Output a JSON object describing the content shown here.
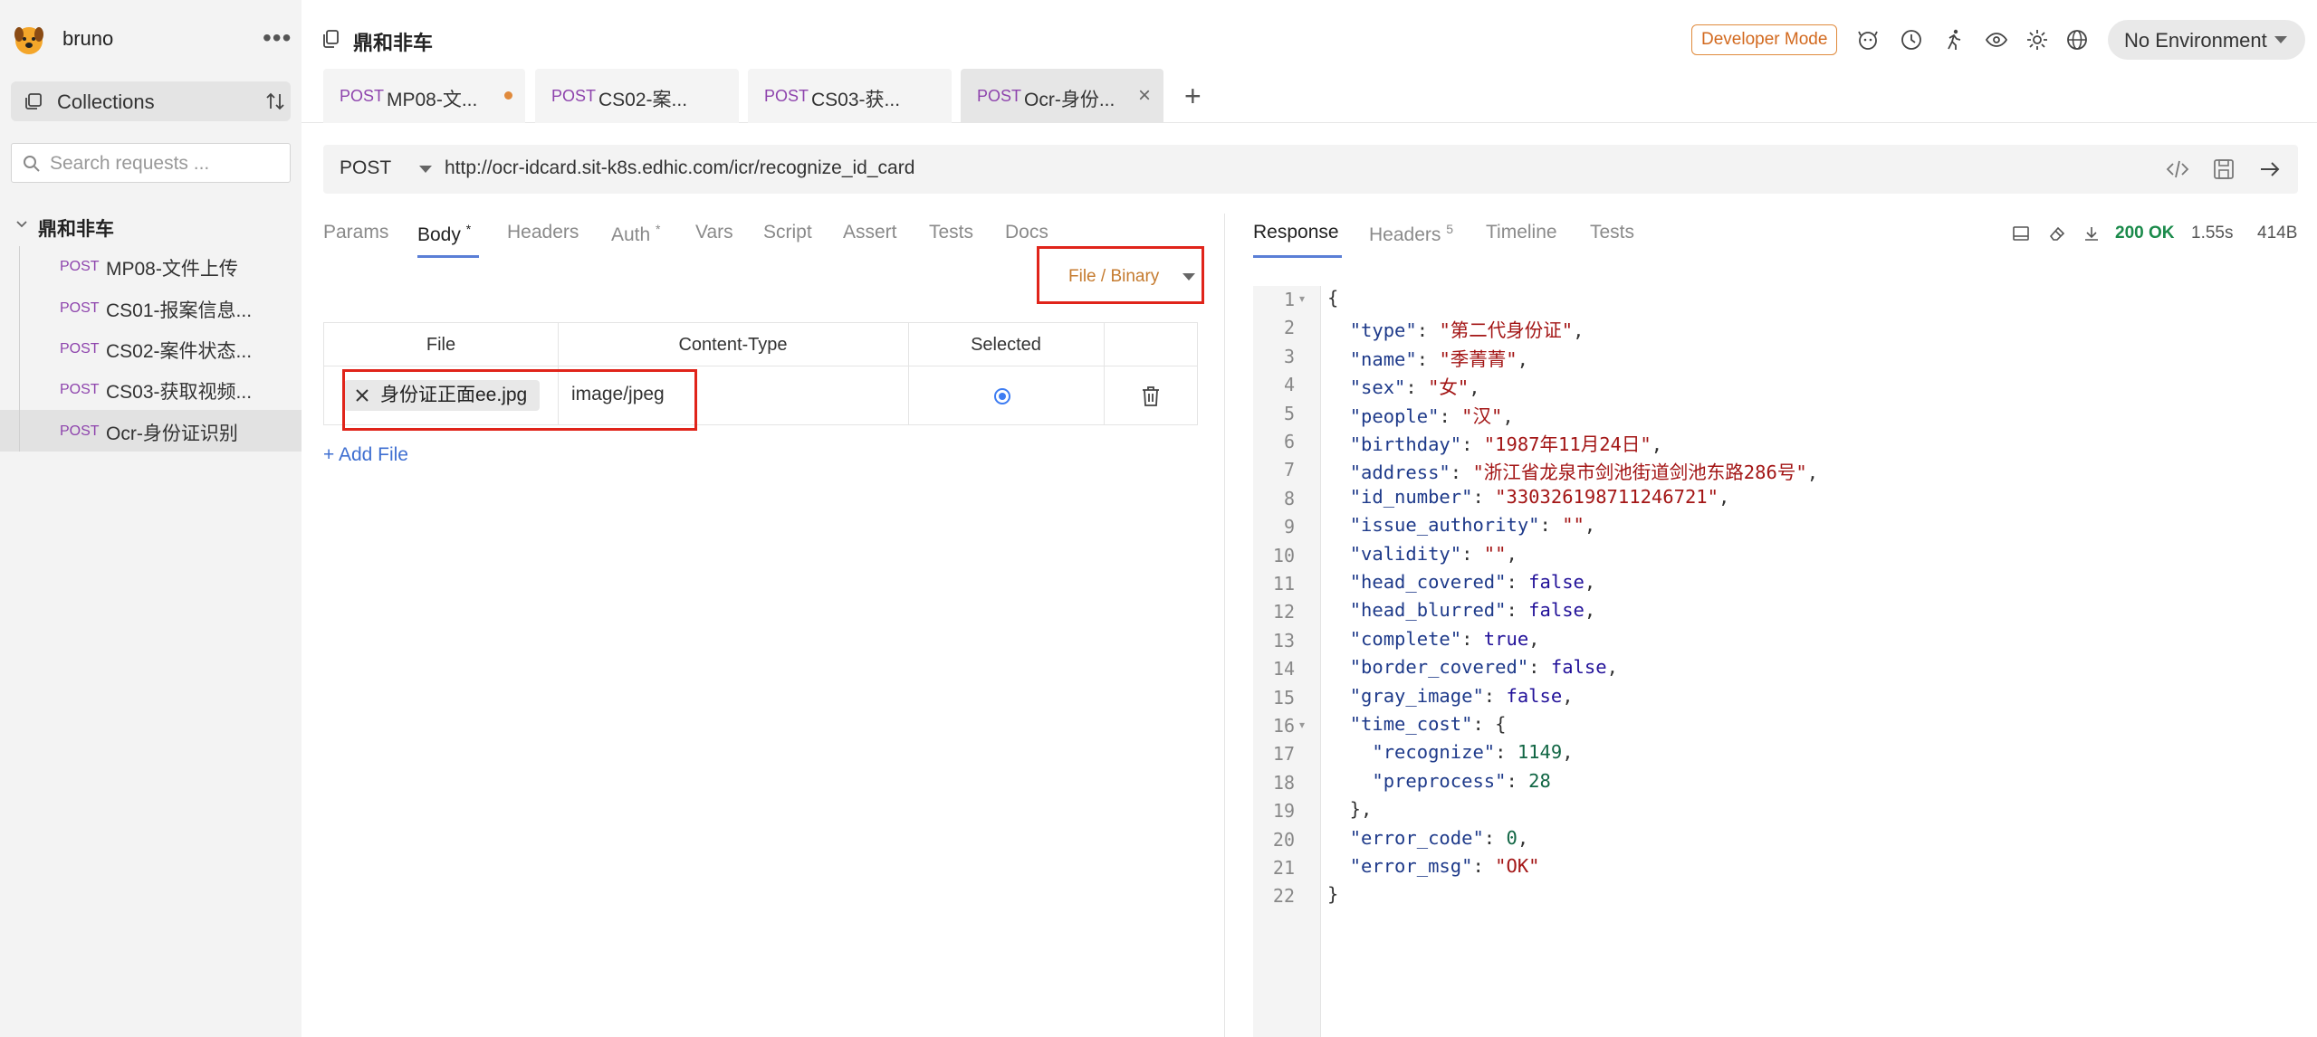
{
  "app": {
    "name": "bruno"
  },
  "sidebar": {
    "collections_label": "Collections",
    "search_placeholder": "Search requests ...",
    "collection_name": "鼎和非车",
    "requests": [
      {
        "method": "POST",
        "name": "MP08-文件上传",
        "active": false
      },
      {
        "method": "POST",
        "name": "CS01-报案信息...",
        "active": false
      },
      {
        "method": "POST",
        "name": "CS02-案件状态...",
        "active": false
      },
      {
        "method": "POST",
        "name": "CS03-获取视频...",
        "active": false
      },
      {
        "method": "POST",
        "name": "Ocr-身份证识别",
        "active": true
      }
    ]
  },
  "topbar": {
    "title": "鼎和非车",
    "developer_mode": "Developer Mode",
    "environment": "No Environment",
    "icons": [
      "dog-icon",
      "history-icon",
      "runner-icon",
      "eye-icon",
      "gear-icon",
      "globe-icon"
    ]
  },
  "tabs": [
    {
      "method": "POST",
      "name": "MP08-文...",
      "unsaved": true
    },
    {
      "method": "POST",
      "name": "CS02-案...",
      "unsaved": false
    },
    {
      "method": "POST",
      "name": "CS03-获...",
      "unsaved": false
    },
    {
      "method": "POST",
      "name": "Ocr-身份...",
      "active": true
    }
  ],
  "request": {
    "method": "POST",
    "url": "http://ocr-idcard.sit-k8s.edhic.com/icr/recognize_id_card",
    "tabs": [
      "Params",
      "Body",
      "Headers",
      "Auth",
      "Vars",
      "Script",
      "Assert",
      "Tests",
      "Docs"
    ],
    "active_tab": "Body",
    "body_mode": "File / Binary",
    "table_headers": [
      "File",
      "Content-Type",
      "Selected"
    ],
    "file": {
      "name": "身份证正面ee.jpg",
      "content_type": "image/jpeg",
      "selected": true
    },
    "add_file": "+ Add File",
    "modified_marker": "*"
  },
  "response": {
    "tabs": [
      "Response",
      "Headers",
      "Timeline",
      "Tests"
    ],
    "headers_count": "5",
    "status": "200 OK",
    "time": "1.55s",
    "size": "414B",
    "line_numbers": [
      "1",
      "2",
      "3",
      "4",
      "5",
      "6",
      "7",
      "8",
      "9",
      "10",
      "11",
      "12",
      "13",
      "14",
      "15",
      "16",
      "17",
      "18",
      "19",
      "20",
      "21",
      "22"
    ],
    "lines": [
      "{",
      "  \"type\": \"第二代身份证\",",
      "  \"name\": \"季菁菁\",",
      "  \"sex\": \"女\",",
      "  \"people\": \"汉\",",
      "  \"birthday\": \"1987年11月24日\",",
      "  \"address\": \"浙江省龙泉市剑池街道剑池东路286号\",",
      "  \"id_number\": \"330326198711246721\",",
      "  \"issue_authority\": \"\",",
      "  \"validity\": \"\",",
      "  \"head_covered\": false,",
      "  \"head_blurred\": false,",
      "  \"complete\": true,",
      "  \"border_covered\": false,",
      "  \"gray_image\": false,",
      "  \"time_cost\": {",
      "    \"recognize\": 1149,",
      "    \"preprocess\": 28",
      "  },",
      "  \"error_code\": 0,",
      "  \"error_msg\": \"OK\"",
      "}"
    ]
  },
  "colors": {
    "accent": "#5a7fd6",
    "method": "#8e44ad",
    "ok": "#1a8a4a",
    "highlight_box": "#e0241a"
  }
}
